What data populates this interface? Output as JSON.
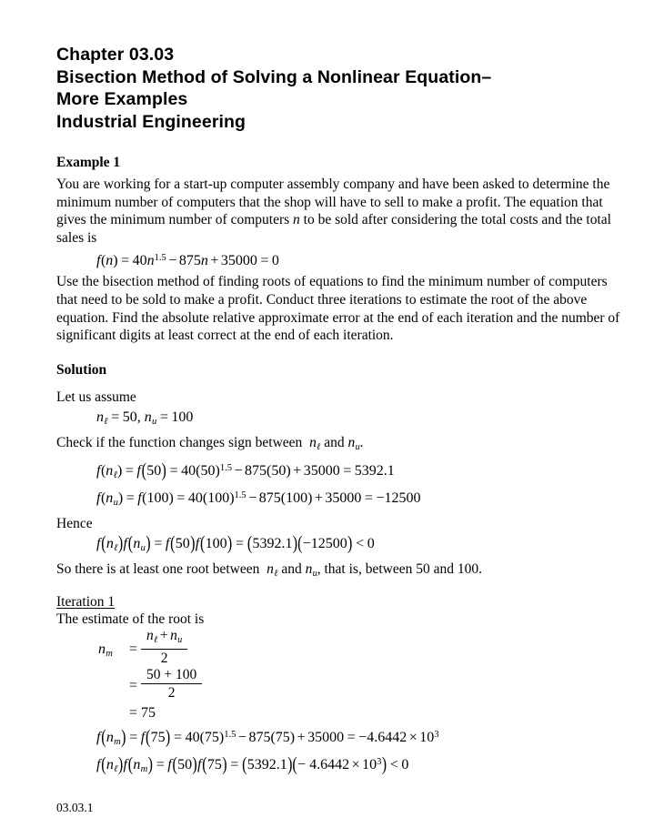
{
  "document": {
    "title_lines": [
      "Chapter 03.03",
      "Bisection Method of Solving a Nonlinear Equation–",
      "More Examples",
      "Industrial Engineering"
    ],
    "footer": "03.03.1"
  },
  "example": {
    "heading": "Example 1",
    "problem_paragraph_1": "You are working for a start-up computer assembly company and have been asked to determine the minimum number of computers that the shop will have to sell to make a profit. The equation that gives the minimum number of computers",
    "problem_paragraph_1_var": "n",
    "problem_paragraph_1_cont": "to be sold after considering the total costs and the total sales is",
    "problem_paragraph_2": "Use the bisection method of finding roots of equations to find the minimum number of computers that need to be sold to make a profit. Conduct three iterations to estimate the root of the above equation. Find the absolute relative approximate error at the end of each iteration and the number of significant digits at least correct at the end of each iteration."
  },
  "equations": {
    "main_function": {
      "f": "f",
      "lparen": "(",
      "var": "n",
      "rparen": ")",
      "eq1": "=",
      "coef": "40",
      "var2": "n",
      "exp": "1.5",
      "minus": "−",
      "term2": "875",
      "var3": "n",
      "plus": "+",
      "term3": "35000",
      "eq2": "=",
      "zero": "0"
    }
  },
  "solution": {
    "heading": "Solution",
    "let_us_assume": "Let us assume",
    "assume_nl_var": "n",
    "assume_nl_sub": "ℓ",
    "assume_nl_eq": "=",
    "assume_nl_val": "50,",
    "assume_nu_var": "n",
    "assume_nu_sub": "u",
    "assume_nu_eq": "=",
    "assume_nu_val": "100",
    "check_text_1": "Check if the function changes sign between",
    "check_and": "and",
    "check_period": ".",
    "hence": "Hence",
    "so_there_1": "So there is at least one root between",
    "so_there_2": "and",
    "so_there_3": ", that is, between 50 and 100."
  },
  "eq_fnl": {
    "lhs_f": "f",
    "lhs_var": "n",
    "lhs_sub": "ℓ",
    "eq1": "=",
    "f2": "f",
    "arg2": "50",
    "eq2": "=",
    "c1": "40",
    "b1": "50",
    "exp": "1.5",
    "minus": "−",
    "c2": "875",
    "b2": "50",
    "plus": "+",
    "c3": "35000",
    "eq3": "=",
    "result": "5392.1"
  },
  "eq_fnu": {
    "lhs_f": "f",
    "lhs_var": "n",
    "lhs_sub": "u",
    "eq1": "=",
    "f2": "f",
    "arg2": "100",
    "eq2": "=",
    "c1": "40",
    "b1": "100",
    "exp": "1.5",
    "minus": "−",
    "c2": "875",
    "b2": "100",
    "plus": "+",
    "c3": "35000",
    "eq3": "=",
    "result": "−12500"
  },
  "eq_product": {
    "f1": "f",
    "v1": "n",
    "s1": "ℓ",
    "f2": "f",
    "v2": "n",
    "s2": "u",
    "eq1": "=",
    "f3": "f",
    "a3": "50",
    "f4": "f",
    "a4": "100",
    "eq2": "=",
    "p1": "5392.1",
    "p2": "−12500",
    "cmp": "<",
    "zero": "0"
  },
  "iteration1": {
    "heading": "Iteration 1",
    "estimate_text": "The estimate of the root is",
    "nm_var": "n",
    "nm_sub": "m",
    "eq": "=",
    "frac1_num_v1": "n",
    "frac1_num_s1": "ℓ",
    "frac1_num_plus": "+",
    "frac1_num_v2": "n",
    "frac1_num_s2": "u",
    "frac1_den": "2",
    "frac2_num": "50 + 100",
    "frac2_den": "2",
    "result_eq": "=",
    "result_val": "75"
  },
  "eq_fnm": {
    "lhs_f": "f",
    "lhs_var": "n",
    "lhs_sub": "m",
    "eq1": "=",
    "f2": "f",
    "arg2": "75",
    "eq2": "=",
    "c1": "40",
    "b1": "75",
    "exp": "1.5",
    "minus": "−",
    "c2": "875",
    "b2": "75",
    "plus": "+",
    "c3": "35000",
    "eq3": "=",
    "res_sign": "−4.6442",
    "res_times": "×",
    "res_base": "10",
    "res_exp": "3"
  },
  "eq_product2": {
    "f1": "f",
    "v1": "n",
    "s1": "ℓ",
    "f2": "f",
    "v2": "n",
    "s2": "m",
    "eq1": "=",
    "f3": "f",
    "a3": "50",
    "f4": "f",
    "a4": "75",
    "eq2": "=",
    "p1": "5392.1",
    "p2a": "− 4.6442",
    "p2times": "×",
    "p2base": "10",
    "p2exp": "3",
    "cmp": "<",
    "zero": "0"
  },
  "colors": {
    "text": "#000000",
    "background": "#ffffff"
  }
}
